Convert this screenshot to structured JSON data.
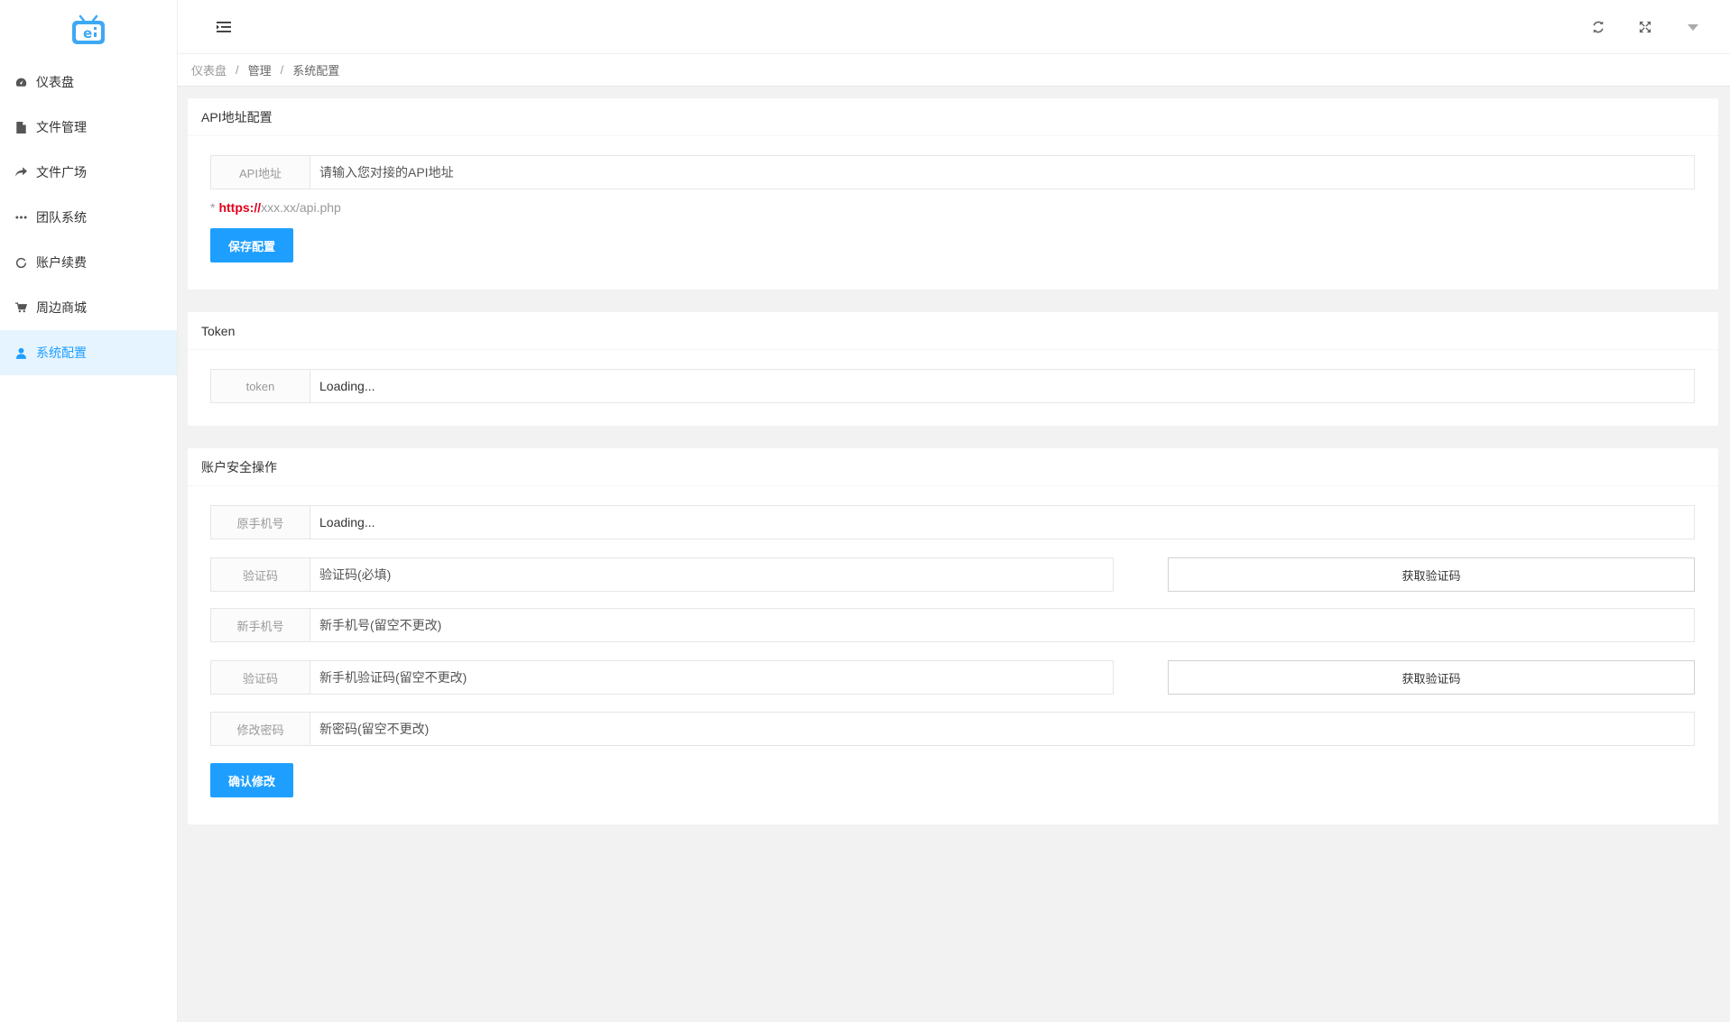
{
  "sidebar": {
    "items": [
      {
        "label": "仪表盘",
        "icon": "dashboard-icon"
      },
      {
        "label": "文件管理",
        "icon": "file-icon"
      },
      {
        "label": "文件广场",
        "icon": "share-icon"
      },
      {
        "label": "团队系统",
        "icon": "ellipsis-icon"
      },
      {
        "label": "账户续费",
        "icon": "refresh-circle-icon"
      },
      {
        "label": "周边商城",
        "icon": "cart-icon"
      },
      {
        "label": "系统配置",
        "icon": "user-icon"
      }
    ],
    "active_index": 6
  },
  "breadcrumb": {
    "items": [
      "仪表盘",
      "管理",
      "系统配置"
    ],
    "separator": "/"
  },
  "api_card": {
    "title": "API地址配置",
    "field_label": "API地址",
    "field_placeholder": "请输入您对接的API地址",
    "hint_prefix": "*",
    "hint_protocol": "https://",
    "hint_rest": "xxx.xx/api.php",
    "save_label": "保存配置"
  },
  "token_card": {
    "title": "Token",
    "field_label": "token",
    "field_value": "Loading..."
  },
  "security_card": {
    "title": "账户安全操作",
    "old_phone_label": "原手机号",
    "old_phone_value": "Loading...",
    "code_label": "验证码",
    "code_placeholder": "验证码(必填)",
    "get_code_label": "获取验证码",
    "new_phone_label": "新手机号",
    "new_phone_placeholder": "新手机号(留空不更改)",
    "new_code_label": "验证码",
    "new_code_placeholder": "新手机验证码(留空不更改)",
    "new_get_code_label": "获取验证码",
    "password_label": "修改密码",
    "password_placeholder": "新密码(留空不更改)",
    "confirm_label": "确认修改"
  },
  "colors": {
    "accent": "#1e9fff",
    "active_bg": "#e6f4ff",
    "protocol_red": "#e0001a",
    "page_bg": "#f2f2f2"
  }
}
